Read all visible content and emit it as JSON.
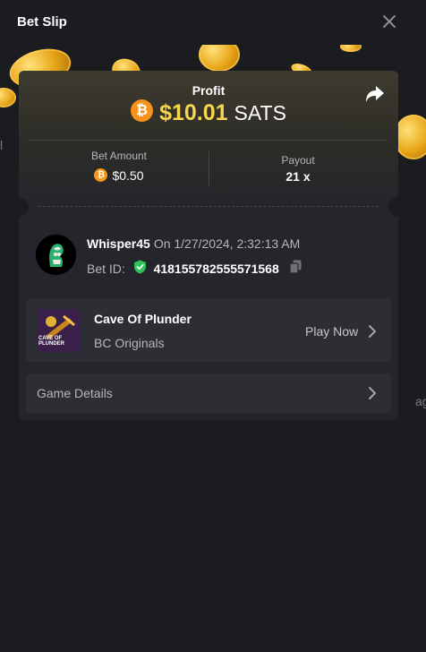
{
  "header": {
    "title": "Bet Slip"
  },
  "profit": {
    "label": "Profit",
    "coin_symbol": "₿",
    "value": "$10.01",
    "unit": "SATS"
  },
  "bet_amount": {
    "label": "Bet Amount",
    "coin_symbol": "₿",
    "value": "$0.50"
  },
  "payout": {
    "label": "Payout",
    "value": "21 x"
  },
  "user": {
    "name": "Whisper45",
    "datetime": "On 1/27/2024, 2:32:13 AM",
    "bet_id_label": "Bet ID:",
    "bet_id": "418155782555571568"
  },
  "game": {
    "title": "Cave Of Plunder",
    "provider": "BC Originals",
    "play_label": "Play Now",
    "thumb_text": "CAVE OF PLUNDER"
  },
  "details": {
    "label": "Game Details"
  },
  "background_edge_text": {
    "left": "l",
    "right": "ag"
  },
  "colors": {
    "accent_gold": "#f5d64c",
    "bitcoin": "#f7931a",
    "verified_green": "#2fc15a",
    "panel_bg": "#1b1c1f",
    "card_bg": "#24262b"
  },
  "icons": {
    "close": "close-icon",
    "share": "share-icon",
    "verified": "shield-check-icon",
    "copy": "copy-icon",
    "chevron": "chevron-right-icon"
  }
}
